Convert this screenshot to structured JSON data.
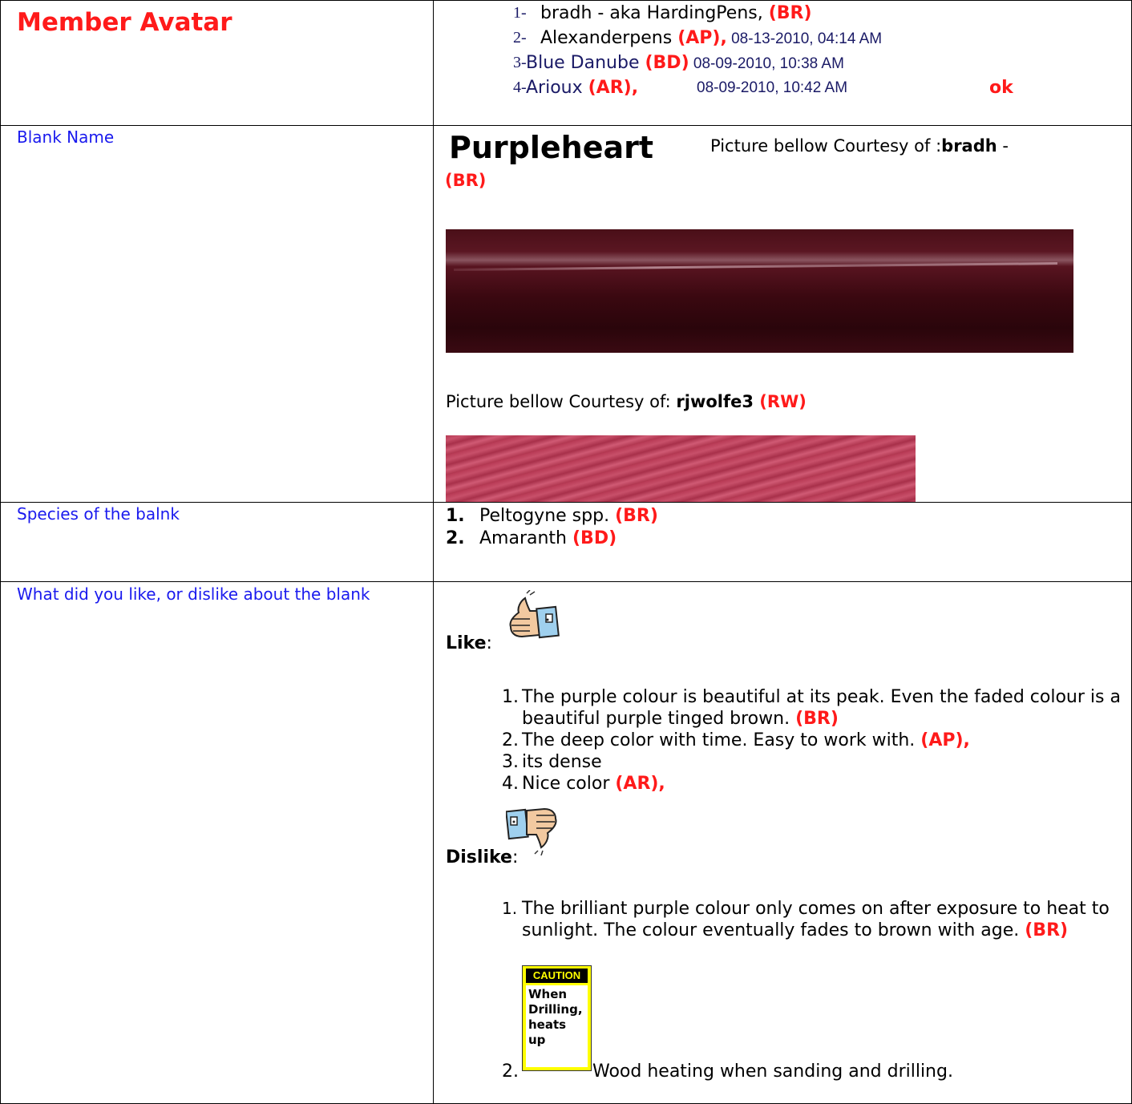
{
  "header": {
    "member_title": "Member Avatar",
    "members": [
      {
        "num": "1-",
        "name": "bradh - aka HardingPens, ",
        "code": "(BR)",
        "date": ""
      },
      {
        "num": "2-",
        "name": "Alexanderpens ",
        "code": "(AP),",
        "date": " 08-13-2010, 04:14 AM"
      },
      {
        "num": "3-",
        "name": "Blue Danube ",
        "code": "(BD)",
        "date": " 08-09-2010, 10:38 AM"
      },
      {
        "num": "4-",
        "name": "Arioux ",
        "code": "(AR),",
        "date": "08-09-2010, 10:42 AM"
      }
    ],
    "ok": "ok"
  },
  "blank": {
    "label": "Blank Name",
    "name": "Purpleheart",
    "courtesy1_prefix": "Picture bellow Courtesy of :",
    "courtesy1_user": "bradh",
    "courtesy1_dash": " -",
    "courtesy1_code": "(BR)",
    "courtesy2_prefix": "Picture bellow Courtesy of: ",
    "courtesy2_user": "rjwolfe3",
    "courtesy2_code": " (RW)"
  },
  "species": {
    "label": "Species of the balnk",
    "items": [
      {
        "num": "1.",
        "text": "Peltogyne spp. ",
        "code": "(BR)"
      },
      {
        "num": "2.",
        "text": "Amaranth ",
        "code": "(BD)"
      }
    ]
  },
  "likes": {
    "label": "What did you like, or dislike about the blank",
    "like_label": "Like",
    "colon": ":",
    "like_items": [
      {
        "num": "1.",
        "text": "The purple colour is beautiful at its peak. Even the faded colour is a beautiful purple tinged brown. ",
        "code": "(BR)"
      },
      {
        "num": "2.",
        "text": "The deep color with time. Easy to work with. ",
        "code": "(AP),"
      },
      {
        "num": "3.",
        "text": "its dense",
        "code": ""
      },
      {
        "num": "4.",
        "text": "Nice color ",
        "code": "(AR),"
      }
    ],
    "dislike_label": "Dislike",
    "dislike_items": [
      {
        "num": "1.",
        "text": "The brilliant purple colour only comes on after exposure to heat to sunlight. The colour eventually fades to brown with age. ",
        "code": "(BR)"
      }
    ],
    "caution_head": "CAUTION",
    "caution_body": "When Drilling, heats up",
    "last_num": "2.",
    "last_text": "Wood heating when sanding and drilling."
  },
  "icons": {
    "thumb_up": "thumbs-up-icon",
    "thumb_down": "thumbs-down-icon"
  },
  "colors": {
    "code_red": "#ff1a1a",
    "label_blue": "#1a1aee",
    "navy": "#1a1a66",
    "caution_yellow": "#ffff00"
  }
}
